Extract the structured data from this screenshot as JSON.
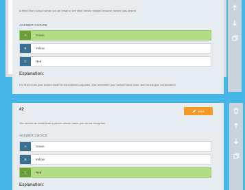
{
  "question1": {
    "text": "A friend from school sends you an email to see what he/she missed because he/she was absent.",
    "choices_heading": "ANSWER CHOICE",
    "choices": [
      {
        "letter": "A",
        "text": "Green",
        "correct": true
      },
      {
        "letter": "B",
        "text": "Yellow",
        "correct": false
      },
      {
        "letter": "C",
        "text": "Red",
        "correct": false
      }
    ],
    "explanation_heading": "Explanation:",
    "explanation": "It is fine to use your school email for educational purposes. Just remember your school honor code, and do not give out answers!"
  },
  "question2": {
    "number": "#2",
    "edit_label": "EDIT",
    "text": "You receive an email from a person whose name you do not recognize.",
    "choices_heading": "ANSWER CHOICE",
    "choices": [
      {
        "letter": "A",
        "text": "Green",
        "correct": false
      },
      {
        "letter": "B",
        "text": "Yellow",
        "correct": false
      },
      {
        "letter": "C",
        "text": "Red",
        "correct": true
      }
    ],
    "explanation_heading": "Explanation:"
  },
  "icons": {
    "move_up": "arrow-up-icon",
    "move_down": "arrow-down-icon",
    "duplicate": "copy-icon",
    "delete": "trash-icon",
    "edit": "pencil-icon"
  },
  "colors": {
    "background": "#45b6e6",
    "card": "#e7ecf0",
    "correct": "#b2dd84",
    "letter_badge": "#3b6f93",
    "edit_button": "#f39a26"
  }
}
